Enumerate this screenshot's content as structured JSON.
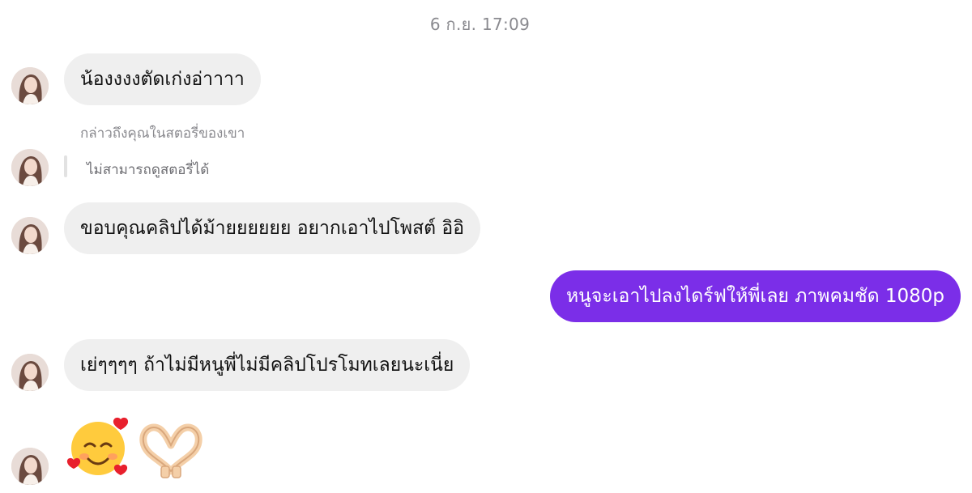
{
  "header": {
    "timestamp": "6 ก.ย. 17:09"
  },
  "messages": [
    {
      "type": "incoming",
      "text": "น้องงงงตัดเก่งอ่าาาา"
    },
    {
      "type": "story_mention",
      "note": "กล่าวถึงคุณในสตอรี่ของเขา",
      "unavailable": "ไม่สามารถดูสตอรี่ได้"
    },
    {
      "type": "incoming",
      "text": "ขอบคุณคลิปได้ม้ายยยยยย อยากเอาไปโพสต์ อิอิ"
    },
    {
      "type": "outgoing",
      "text": "หนูจะเอาไปลงไดร์ฟให้พี่เลย ภาพคมชัด 1080p"
    },
    {
      "type": "incoming",
      "text": "เย่ๆๆๆๆ ถ้าไม่มีหนูพี่ไม่มีคลิปโปรโมทเลยนะเนี่ย"
    },
    {
      "type": "incoming_emoji",
      "emojis": [
        "smiling-face-with-hearts-icon",
        "heart-hands-icon"
      ]
    }
  ],
  "colors": {
    "outgoing_bubble": "#7b2ee8",
    "incoming_bubble": "#efefef",
    "meta_text": "#8a8a8f"
  }
}
